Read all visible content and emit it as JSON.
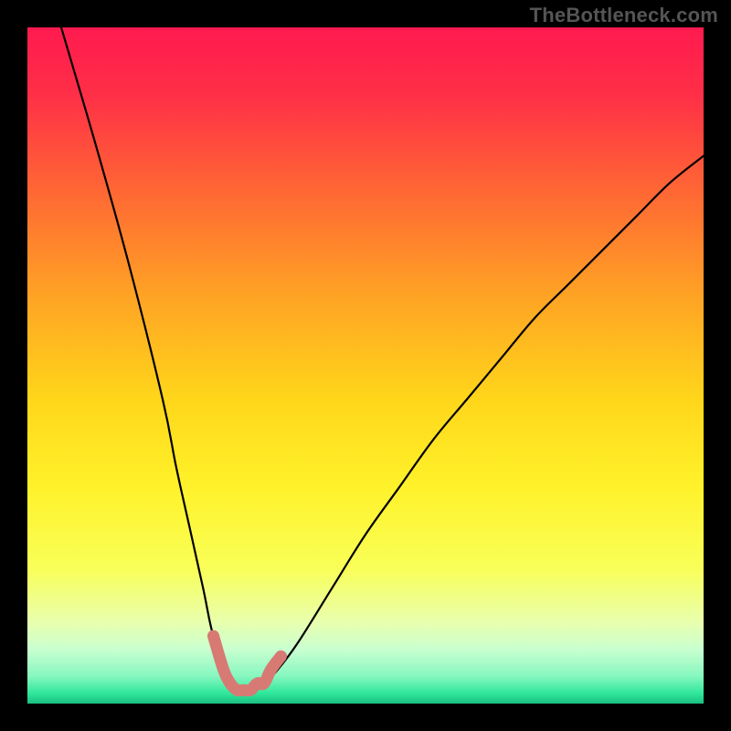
{
  "attribution": "TheBottleneck.com",
  "chart_data": {
    "type": "line",
    "title": "",
    "xlabel": "",
    "ylabel": "",
    "xlim": [
      0,
      100
    ],
    "ylim": [
      0,
      100
    ],
    "grid": false,
    "legend": false,
    "series": [
      {
        "name": "bottleneck-curve",
        "color": "#000000",
        "x": [
          5,
          10,
          15,
          20,
          22,
          24,
          26,
          27,
          28,
          29,
          30,
          31.5,
          33,
          35,
          37,
          40,
          45,
          50,
          55,
          60,
          65,
          70,
          75,
          80,
          85,
          90,
          95,
          100
        ],
        "y": [
          100,
          83,
          65,
          45,
          35,
          26,
          17,
          12,
          8,
          5,
          3,
          2,
          2,
          3,
          5,
          9,
          17,
          25,
          32,
          39,
          45,
          51,
          57,
          62,
          67,
          72,
          77,
          81
        ]
      },
      {
        "name": "bottleneck-minimum-highlight",
        "color": "#d77a74",
        "x": [
          27.5,
          29,
          30,
          31,
          32,
          33,
          34,
          35,
          36,
          37.5
        ],
        "y": [
          10,
          5,
          3,
          2,
          2,
          2,
          3,
          3,
          5,
          7
        ]
      }
    ],
    "gradient_stops": [
      {
        "offset": 0.0,
        "color": "#ff1a4f"
      },
      {
        "offset": 0.1,
        "color": "#ff2f47"
      },
      {
        "offset": 0.25,
        "color": "#ff6a33"
      },
      {
        "offset": 0.4,
        "color": "#ffa424"
      },
      {
        "offset": 0.55,
        "color": "#ffd61a"
      },
      {
        "offset": 0.68,
        "color": "#fff22a"
      },
      {
        "offset": 0.8,
        "color": "#f9ff58"
      },
      {
        "offset": 0.88,
        "color": "#e8ffae"
      },
      {
        "offset": 0.92,
        "color": "#c9ffd0"
      },
      {
        "offset": 0.96,
        "color": "#85f7bf"
      },
      {
        "offset": 0.985,
        "color": "#2fe79a"
      },
      {
        "offset": 1.0,
        "color": "#1abf82"
      }
    ]
  }
}
